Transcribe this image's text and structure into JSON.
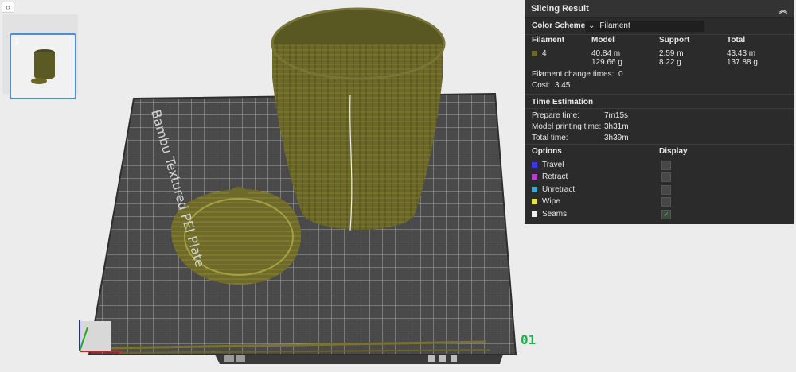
{
  "thumbnail": {
    "number": "1"
  },
  "plate": {
    "label": "Bambu Textured PEI Plate",
    "layer_label": "01"
  },
  "slicing": {
    "title": "Slicing Result",
    "color_scheme_label": "Color Scheme",
    "color_scheme_value": "Filament",
    "headers": {
      "filament": "Filament",
      "model": "Model",
      "support": "Support",
      "total": "Total"
    },
    "filament_row": {
      "id": "4",
      "swatch_color": "#6b6a2c",
      "model_len": "40.84 m",
      "model_weight": "129.66 g",
      "support_len": "2.59 m",
      "support_weight": "8.22 g",
      "total_len": "43.43 m",
      "total_weight": "137.88 g"
    },
    "change_times_label": "Filament change times:",
    "change_times_value": "0",
    "cost_label": "Cost:",
    "cost_value": "3.45",
    "time_title": "Time Estimation",
    "prepare_label": "Prepare time:",
    "prepare_value": "7m15s",
    "model_time_label": "Model printing time:",
    "model_time_value": "3h31m",
    "total_time_label": "Total time:",
    "total_time_value": "3h39m",
    "options_label": "Options",
    "display_label": "Display",
    "options": [
      {
        "label": "Travel",
        "color": "#3a3ad6",
        "checked": false
      },
      {
        "label": "Retract",
        "color": "#c43ad0",
        "checked": false
      },
      {
        "label": "Unretract",
        "color": "#3aa8d6",
        "checked": false
      },
      {
        "label": "Wipe",
        "color": "#e8e23a",
        "checked": false
      },
      {
        "label": "Seams",
        "color": "#eeeeee",
        "checked": true
      }
    ]
  }
}
